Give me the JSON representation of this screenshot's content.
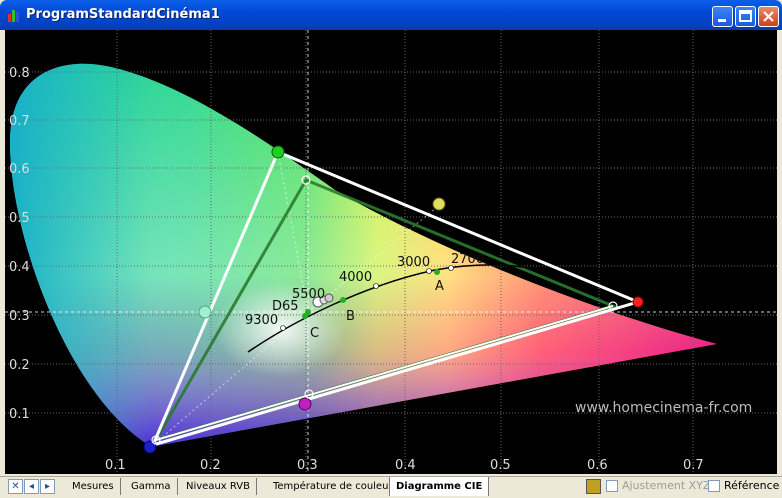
{
  "window": {
    "title": "ProgramStandardCinéma1"
  },
  "chart_data": {
    "type": "scatter",
    "title": "Diagramme CIE",
    "x_ticks": [
      "0.1",
      "0.2",
      "0.3",
      "0.4",
      "0.5",
      "0.6",
      "0.7"
    ],
    "y_ticks": [
      "0.8",
      "0.7",
      "0.6",
      "0.5",
      "0.4",
      "0.3",
      "0.2",
      "0.1"
    ],
    "xlim": [
      0,
      0.8
    ],
    "ylim": [
      0,
      0.9
    ],
    "target_gamut": {
      "name": "reference",
      "points": [
        [
          0.64,
          0.33
        ],
        [
          0.3,
          0.6
        ],
        [
          0.15,
          0.06
        ]
      ]
    },
    "measured_gamut": {
      "name": "measured",
      "points": [
        [
          0.645,
          0.335
        ],
        [
          0.28,
          0.665
        ],
        [
          0.14,
          0.045
        ]
      ]
    },
    "secondaries_measured": [
      [
        0.42,
        0.51
      ],
      [
        0.21,
        0.33
      ],
      [
        0.3,
        0.14
      ]
    ],
    "white_point_labels": {
      "D65": "D65",
      "A": "A",
      "B": "B",
      "C": "C"
    },
    "cct_labels": [
      "9300",
      "5500",
      "4000",
      "3000",
      "2700"
    ],
    "crosshair": [
      0.3127,
      0.329
    ]
  },
  "watermark": "www.homecinema-fr.com",
  "tabs": [
    {
      "label": "Mesures"
    },
    {
      "label": "Gamma"
    },
    {
      "label": "Niveaux RVB"
    },
    {
      "label": "Température de couleur"
    },
    {
      "label": "Diagramme CIE"
    }
  ],
  "active_tab": "Diagramme CIE",
  "options": {
    "ajustement_label": "Ajustement XYZ",
    "reference_label": "Référence"
  }
}
